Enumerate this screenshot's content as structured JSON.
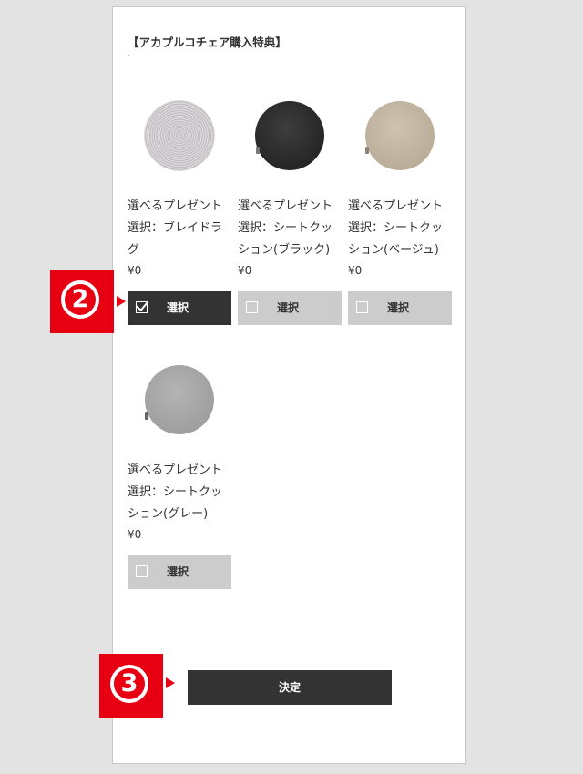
{
  "section": {
    "title": "【アカプルコチェア購入特典】"
  },
  "products": [
    {
      "name": "選べるプレゼント 選択：ブレイドラグ",
      "price": "¥0",
      "button": "選択",
      "checked": true,
      "image": "braid-rug"
    },
    {
      "name": "選べるプレゼント 選択：シートクッション(ブラック)",
      "price": "¥0",
      "button": "選択",
      "checked": false,
      "image": "seat-cushion-black"
    },
    {
      "name": "選べるプレゼント 選択：シートクッション(ベージュ)",
      "price": "¥0",
      "button": "選択",
      "checked": false,
      "image": "seat-cushion-beige"
    },
    {
      "name": "選べるプレゼント 選択：シートクッション(グレー)",
      "price": "¥0",
      "button": "選択",
      "checked": false,
      "image": "seat-cushion-gray"
    }
  ],
  "confirm": {
    "label": "決定"
  },
  "markers": [
    {
      "label": "2"
    },
    {
      "label": "3"
    }
  ],
  "colors": {
    "accent": "#e60012",
    "button_dark": "#333333",
    "button_light": "#cccccc",
    "background": "#e3e3e3"
  }
}
